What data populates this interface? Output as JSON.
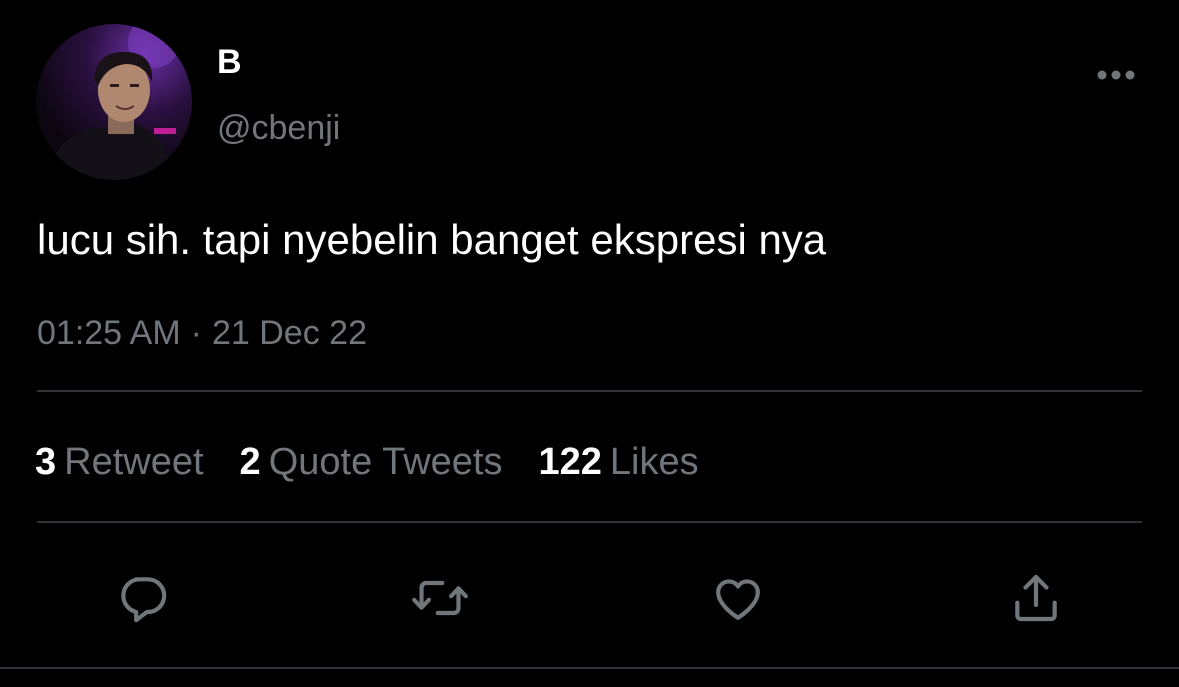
{
  "tweet": {
    "display_name": "B",
    "handle": "@cbenji",
    "text": "lucu sih. tapi nyebelin banget ekspresi nya",
    "time": "01:25 AM",
    "separator": "·",
    "date": "21 Dec 22"
  },
  "stats": [
    {
      "count": "3",
      "label": "Retweet"
    },
    {
      "count": "2",
      "label": "Quote Tweets"
    },
    {
      "count": "122",
      "label": "Likes"
    }
  ],
  "actions": [
    {
      "icon": "reply-icon"
    },
    {
      "icon": "retweet-icon"
    },
    {
      "icon": "like-heart-icon"
    },
    {
      "icon": "share-icon"
    }
  ],
  "icons": {
    "more": "more-horizontal-icon",
    "avatar": "profile-avatar"
  },
  "colors": {
    "background": "#000000",
    "primary_text": "#ffffff",
    "secondary_text": "#71767b",
    "divider": "#2f3336",
    "icon": "#71767b"
  }
}
